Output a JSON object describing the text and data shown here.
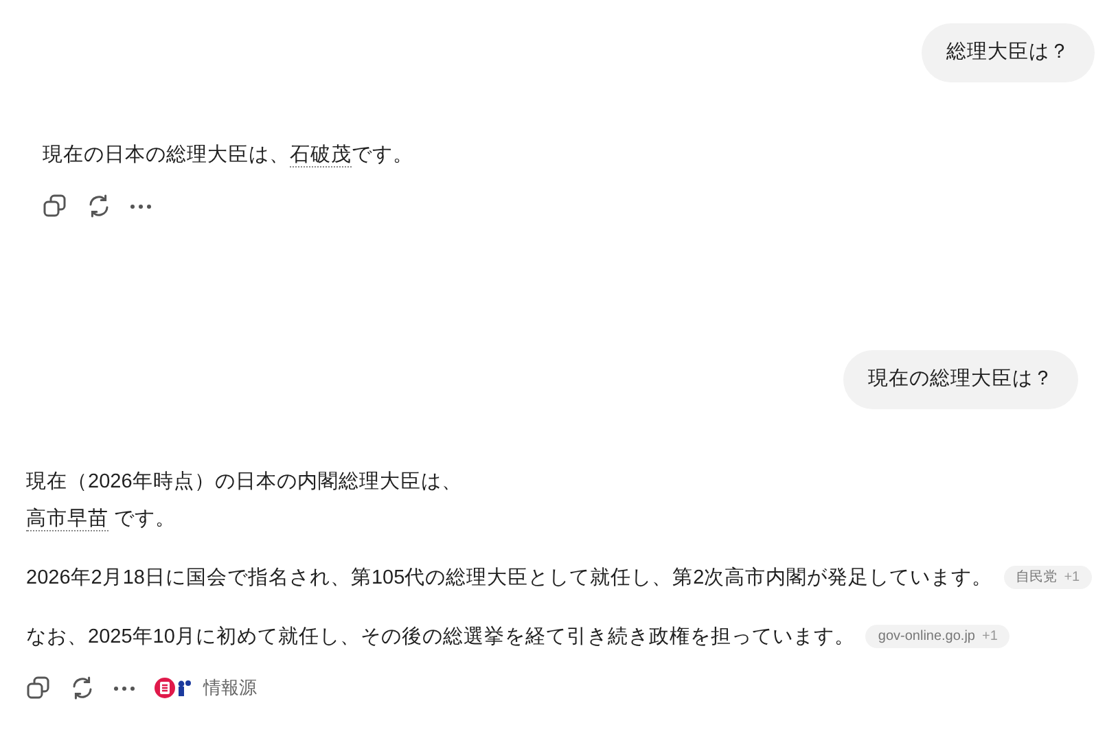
{
  "messages": [
    {
      "kind": "user",
      "text": "総理大臣は？"
    },
    {
      "kind": "answer",
      "paragraphs": [
        [
          {
            "kind": "text",
            "text": "現在の日本の総理大臣は、"
          },
          {
            "kind": "link",
            "text": "石破茂"
          },
          {
            "kind": "text",
            "text": "です。"
          }
        ]
      ]
    },
    {
      "kind": "user",
      "text": "現在の総理大臣は？"
    },
    {
      "kind": "answer",
      "paragraphs": [
        [
          {
            "kind": "text",
            "text": "現在（2026年時点）の日本の内閣総理大臣は、"
          },
          {
            "kind": "break"
          },
          {
            "kind": "link",
            "text": "高市早苗"
          },
          {
            "kind": "text",
            "text": " です。"
          }
        ],
        [
          {
            "kind": "text",
            "text": "2026年2月18日に国会で指名され、第105代の総理大臣として就任し、第2次高市内閣が発足しています。"
          },
          {
            "kind": "chip",
            "label": "自民党",
            "count": "+1"
          }
        ],
        [
          {
            "kind": "text",
            "text": "なお、2025年10月に初めて就任し、その後の総選挙を経て引き続き政権を担っています。"
          },
          {
            "kind": "chip",
            "label": "gov-online.go.jp",
            "count": "+1"
          }
        ]
      ],
      "sources_label": "情報源"
    }
  ]
}
